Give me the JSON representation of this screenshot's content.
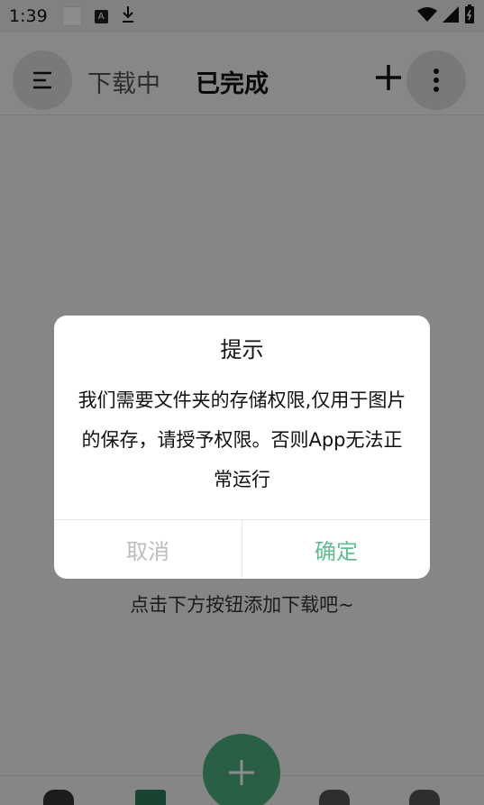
{
  "status_bar": {
    "time": "1:39"
  },
  "app_bar": {
    "tab_downloading": "下载中",
    "tab_completed": "已完成"
  },
  "empty_hint": "点击下方按钮添加下载吧~",
  "dialog": {
    "title": "提示",
    "message": "我们需要文件夹的存储权限,仅用于图片的保存，请授予权限。否则App无法正常运行",
    "cancel_label": "取消",
    "confirm_label": "确定"
  },
  "colors": {
    "accent": "#4caf7f",
    "confirm_text": "#5fbf93",
    "cancel_text": "#bdbdbd"
  }
}
